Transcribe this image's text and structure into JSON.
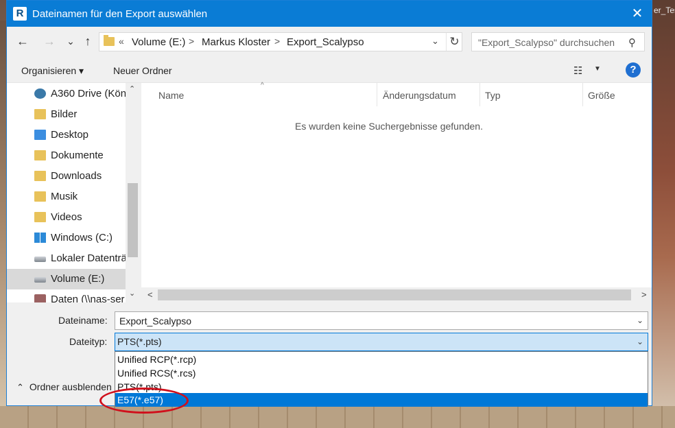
{
  "background": {
    "window_text": "er_Tes"
  },
  "window": {
    "app_icon_letter": "R",
    "title": "Dateinamen für den Export auswählen",
    "close": "✕"
  },
  "nav": {
    "back": "←",
    "forward": "→",
    "recent": "⌄",
    "up": "↑"
  },
  "address": {
    "overflow": "«",
    "crumbs": [
      "Volume (E:)",
      "Markus Kloster",
      "Export_Scalypso"
    ],
    "separator": ">",
    "dropdown": "⌄",
    "refresh": "↻"
  },
  "search": {
    "placeholder": "\"Export_Scalypso\" durchsuchen",
    "icon": "⚲"
  },
  "toolbar": {
    "organize": "Organisieren ▾",
    "new_folder": "Neuer Ordner",
    "view_icon": "☷",
    "view_dd": "▼",
    "help": "?"
  },
  "sidebar": {
    "items": [
      {
        "label": "A360 Drive (Kön",
        "icon": "cloud-drive-icon"
      },
      {
        "label": "Bilder",
        "icon": "pictures-folder-icon"
      },
      {
        "label": "Desktop",
        "icon": "desktop-folder-icon"
      },
      {
        "label": "Dokumente",
        "icon": "documents-folder-icon"
      },
      {
        "label": "Downloads",
        "icon": "downloads-folder-icon"
      },
      {
        "label": "Musik",
        "icon": "music-folder-icon"
      },
      {
        "label": "Videos",
        "icon": "videos-folder-icon"
      },
      {
        "label": "Windows (C:)",
        "icon": "windows-drive-icon"
      },
      {
        "label": "Lokaler Datenträ",
        "icon": "local-drive-icon"
      },
      {
        "label": "Volume (E:)",
        "icon": "volume-drive-icon",
        "selected": true
      },
      {
        "label": "Daten (\\\\nas-ser",
        "icon": "network-drive-icon"
      }
    ],
    "scroll_up": "⌃",
    "scroll_down": "⌄"
  },
  "columns": {
    "name": "Name",
    "modified": "Änderungsdatum",
    "type": "Typ",
    "size": "Größe",
    "sort": "^"
  },
  "empty_message": "Es wurden keine Suchergebnisse gefunden.",
  "hscroll": {
    "left": "<",
    "right": ">"
  },
  "fields": {
    "filename_label": "Dateiname:",
    "filename_value": "Export_Scalypso",
    "filetype_label": "Dateityp:",
    "filetype_value": "PTS(*.pts)",
    "chevron": "⌄"
  },
  "filetype_options": [
    "Unified RCP(*.rcp)",
    "Unified RCS(*.rcs)",
    "PTS(*.pts)",
    "E57(*.e57)"
  ],
  "hide_folders": {
    "chev": "⌃",
    "label": "Ordner ausblenden"
  },
  "colors": {
    "accent": "#0a7cd5",
    "selection": "#0078d7",
    "annotation": "#d0101c"
  }
}
